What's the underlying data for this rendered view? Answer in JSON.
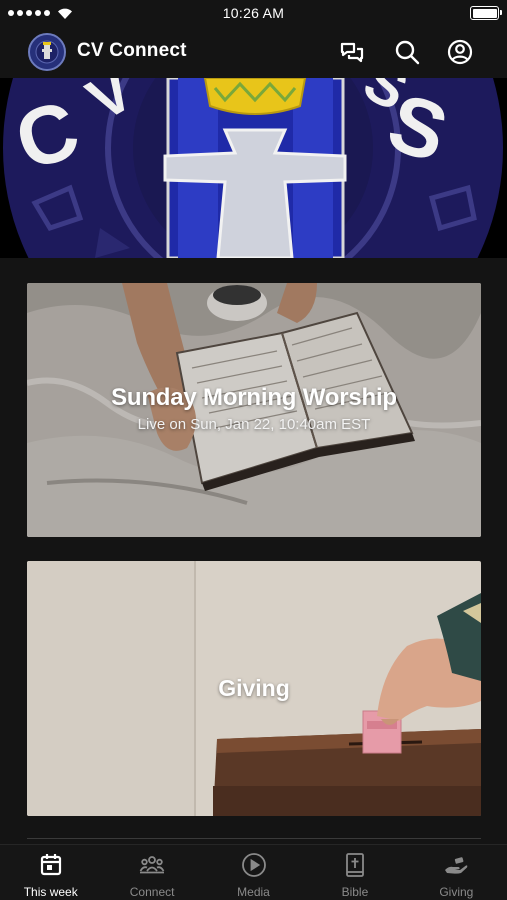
{
  "status_bar": {
    "time": "10:26 AM"
  },
  "header": {
    "title": "CV Connect",
    "icons": [
      "chat-icon",
      "search-icon",
      "profile-icon"
    ]
  },
  "cards": [
    {
      "title": "Sunday Morning Worship",
      "subtitle": "Live on Sun, Jan 22, 10:40am EST"
    },
    {
      "title": "Giving"
    }
  ],
  "tabs": [
    {
      "label": "This week",
      "icon": "calendar-icon",
      "active": true
    },
    {
      "label": "Connect",
      "icon": "people-icon",
      "active": false
    },
    {
      "label": "Media",
      "icon": "play-icon",
      "active": false
    },
    {
      "label": "Bible",
      "icon": "bible-icon",
      "active": false
    },
    {
      "label": "Giving",
      "icon": "giving-icon",
      "active": false
    }
  ],
  "colors": {
    "background": "#141414",
    "active_tab": "#ffffff",
    "inactive_tab": "#8a8a8a",
    "logo_navy": "#1d1a5c",
    "logo_gold": "#e8c51a"
  }
}
